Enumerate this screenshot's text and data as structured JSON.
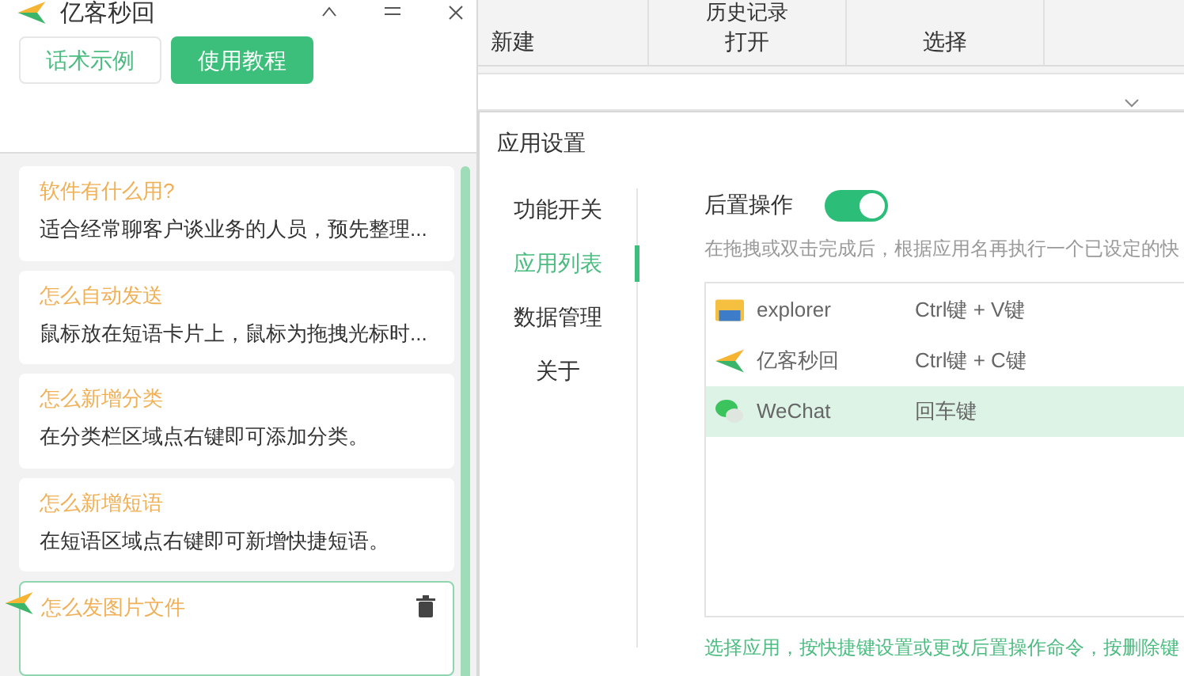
{
  "left_panel": {
    "title": "亿客秒回",
    "tabs": [
      {
        "label": "话术示例",
        "selected": false
      },
      {
        "label": "使用教程",
        "selected": true
      }
    ],
    "cards": [
      {
        "title": "软件有什么用?",
        "body": "适合经常聊客户谈业务的人员，预先整理...",
        "active": false
      },
      {
        "title": "怎么自动发送",
        "body": "鼠标放在短语卡片上，鼠标为拖拽光标时...",
        "active": false
      },
      {
        "title": "怎么新增分类",
        "body": "在分类栏区域点右键即可添加分类。",
        "active": false
      },
      {
        "title": "怎么新增短语",
        "body": "在短语区域点右键即可新增快捷短语。",
        "active": false
      },
      {
        "title": "怎么发图片文件",
        "active": true
      }
    ]
  },
  "ribbon": {
    "groups": [
      {
        "label": "新建"
      },
      {
        "label": "打开",
        "item": "历史记录"
      },
      {
        "label": "选择"
      }
    ]
  },
  "dialog": {
    "title": "应用设置",
    "nav": [
      {
        "label": "功能开关",
        "selected": false
      },
      {
        "label": "应用列表",
        "selected": true
      },
      {
        "label": "数据管理",
        "selected": false
      },
      {
        "label": "关于",
        "selected": false
      }
    ],
    "post_action": {
      "label": "后置操作",
      "on": true
    },
    "description": "在拖拽或双击完成后，根据应用名再执行一个已设定的快",
    "apps": [
      {
        "name": "explorer",
        "shortcut": "Ctrl键 + V键",
        "kind": "folder",
        "selected": false
      },
      {
        "name": "亿客秒回",
        "shortcut": "Ctrl键 + C键",
        "kind": "plane",
        "selected": false
      },
      {
        "name": "WeChat",
        "shortcut": "回车键",
        "kind": "chat",
        "selected": true
      }
    ],
    "hint": "选择应用，按快捷键设置或更改后置操作命令，按删除键"
  }
}
